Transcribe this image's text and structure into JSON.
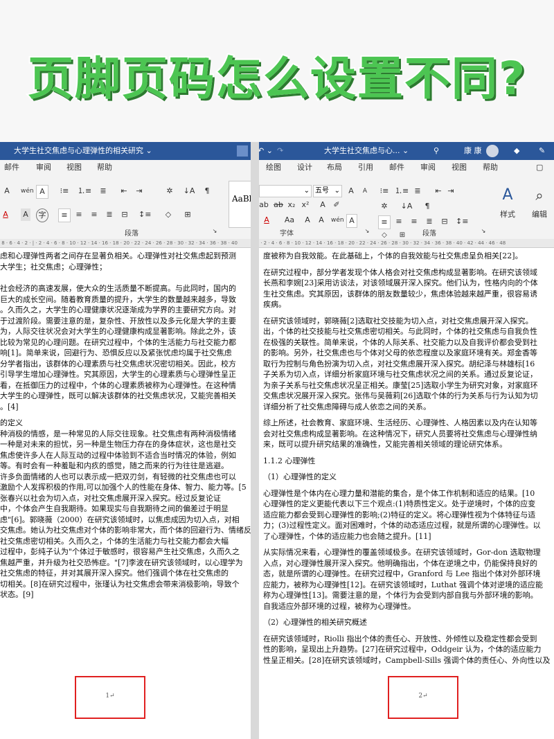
{
  "banner": {
    "title": "页脚页码怎么设置不同?"
  },
  "left_window": {
    "doc_title": "大学生社交焦虑与心理弹性的相关研究 ⌄",
    "tabs": [
      "邮件",
      "审阅",
      "视图",
      "帮助"
    ],
    "group_label": "段落",
    "style_preview": "AaBl",
    "paragraphs": [
      "虑和心理弹性两者之间存在显著负相关。心理弹性对社交焦虑起到预测",
      "大学生；社交焦虑；心理弹性；",
      "",
      "",
      "社会经济的高速发展，使大众的生活质量不断提高。与此同时，国内的",
      "巨大的成长空间。随着教育质量的提升，大学生的数量越来越多，导致",
      "。久而久之，大学生的心理健康状况逐渐成为学界的主要研究方向。对",
      "于过渡阶段。需要注意的是，复杂性、开放性以及多元化是大学的主要",
      "为，人际交往状况会对大学生的心理健康构成显著影响。除此之外，该",
      "比较为常见的心理问题。在研究过程中，个体的生活能力与社交能力都",
      "响[1]。简单来说，回避行为、恐惧反应以及紧张忧虑均属于社交焦虑",
      "分学者指出，该群体的心理素质与社交焦虑状况密切相关。因此，校方",
      "引导学生增加心理弹性。究其原因，大学生的心理素质与心理弹性呈正",
      "看，在抵御压力的过程中，个体的心理素质被称为心理弹性。在这种情",
      "大学生的心理弹性，既可以解决该群体的社交焦虑状况，又能完善相关",
      "。[4]",
      "",
      "的定义",
      "种消极的情感，是一种常见的人际交往现象。社交焦虑有两种消极情绪",
      "一种是对未来的担忧，另一种是生物压力存在的身体症状，这也是社交",
      "焦虑使许多人在人际互动的过程中体验到不适合当时情况的体验，例如",
      "等。有时会有一种羞耻和内疚的感觉，随之而来的行为往往是逃避。",
      "许多负面情绪的人也可以表示成一把双刃剑，有轻微的社交焦虑也可以",
      "激励个人发挥积极的作用,可以加强个人的性能在身体、智力、能力等。[5",
      "张春兴以社会为切入点，对社交焦虑展开深入探究。经过反复论证",
      "中，个体会产生自我期待。如果现实与自我期待之间的偏差过于明显",
      "虑\"[6]。郭晓薇（2000）在研究该领域时，以焦虑成因为切入点，对相",
      "交焦虑。她认为社交焦虑对个体的影响非常大，而个体的回避行为、情绪反",
      "社交焦虑密切相关。久而久之，个体的生活能力与社交能力都会大幅",
      "过程中，彭纯子认为\"个体过于敏感时，很容易产生社交焦虑，久而久之",
      "焦越严重，并升级为社交恐怖症。\"[7]李波在研究该领域时，以心理学为",
      "社交焦虑的特征，并对其展开深入探究。他们强调个体在社交焦虑的",
      "切相关。[8]在研究过程中，张瑾认为社交焦虑会带来消极影响，导致个",
      "状态。[9]"
    ],
    "footer_page_number": "1↵"
  },
  "right_window": {
    "doc_title": "大学生社交焦虑与心... ⌄",
    "user_name": "康 康",
    "tabs": [
      "绘图",
      "设计",
      "布局",
      "引用",
      "邮件",
      "审阅",
      "视图",
      "帮助"
    ],
    "font_size_value": "五号",
    "group_labels": [
      "字体",
      "段落"
    ],
    "style_button_label": "样式",
    "edit_button_label": "编辑",
    "paragraphs": [
      "度被称为自我效能。在此基础上，个体的自我效能与社交焦虑呈负相关[22]。",
      "",
      "在研究过程中，部分学者发现个体人格会对社交焦虑构成显著影响。在研究该领域",
      "长燕和李婉[23]采用访谈法，对该领域展开深入探究。他们认为，性格内向的个体",
      "生社交焦虑。究其原因，该群体的朋友数量较少，焦虑体验越来越严重，很容易诱",
      "疾病。",
      "",
      "在研究该领域时，郭晓薇[2]选取社交技能为切入点，对社交焦虑展开深入探究。",
      "出，个体的社交技能与社交焦虑密切相关。与此同时，个体的社交焦虑与自我负性",
      "在极强的关联性。简单来说，个体的人际关系、社交能力以及自我评价都会受到社",
      "的影响。另外，社交焦虑也与个体对父母的依恋程度以及家庭环境有关。郑金香等",
      "取行为控制与角色扮演为切入点，对社交焦虑展开深入探究。胡纪泽与林雄标[16",
      "子关系为切入点，详细分析家庭环境与社交焦虑状况之间的关系。通过反复论证，",
      "为亲子关系与社交焦虑状况呈正相关。康莹[25]选取小学生为研究对象，对家庭环",
      "交焦虑状况展开深入探究。张伟与吴薇莉[26]选取个体的行为关系与行为认知为切",
      "详细分析了社交焦虑障碍与成人依恋之间的关系。",
      "",
      "综上所述，社会教育、家庭环境、生活经历、心理弹性、人格因素以及内在认知等",
      "会对社交焦虑构成显著影响。在这种情况下，研究人员要将社交焦虑与心理弹性纳",
      "来，既可以提升研究结果的准确性，又能完善相关领域的理论研究体系。",
      "",
      "1.1.2 心理弹性",
      "",
      "（1）心理弹性的定义",
      "",
      "心理弹性是个体内在心理力量和潜能的集合，是个体工作机制和适应的结果。[10",
      "心理弹性的定义更能代表以下三个观点:(1)特质性定义。处于逆境时，个体的应变",
      "适应能力都会受到心理弹性的影响;(2)特征的定义。将心理弹性视为个体特征与适",
      "力；(3)过程性定义。面对困难时，个体的动态适应过程，就是所谓的心理弹性。以",
      "了心理弹性，个体的适应能力也会随之提升。[11]",
      "",
      "从实际情况来看，心理弹性的覆盖领域极多。在研究该领域时，Gor-don 选取物理",
      "入点，对心理弹性展开深入探究。他明确指出，个体在逆境之中，仍能保持良好的",
      "态，就是所谓的心理弹性。在研究过程中，Granford 与 Lee 指出个体对外部环境",
      "应能力，被称为心理弹性[12]。在研究该领域时，Luthat 强调个体对逆境的适应能",
      "称为心理弹性[13]。需要注意的是，个体行为会受到内部自我与外部环境的影响。",
      "自我适应外部环境的过程，被称为心理弹性。",
      "",
      "（2）心理弹性的相关研究概述",
      "",
      "在研究该领域时，Riolli 指出个体的责任心、开放性、外倾性以及稳定性都会受到",
      "性的影响，呈现出上升趋势。[27]在研究过程中，Oddgeir 认为，个体的适应能力",
      "性呈正相关。[28]在研究该领域时，Campbell-Sills 强调个体的责任心、外向性以及"
    ],
    "footer_page_number": "2↵"
  }
}
